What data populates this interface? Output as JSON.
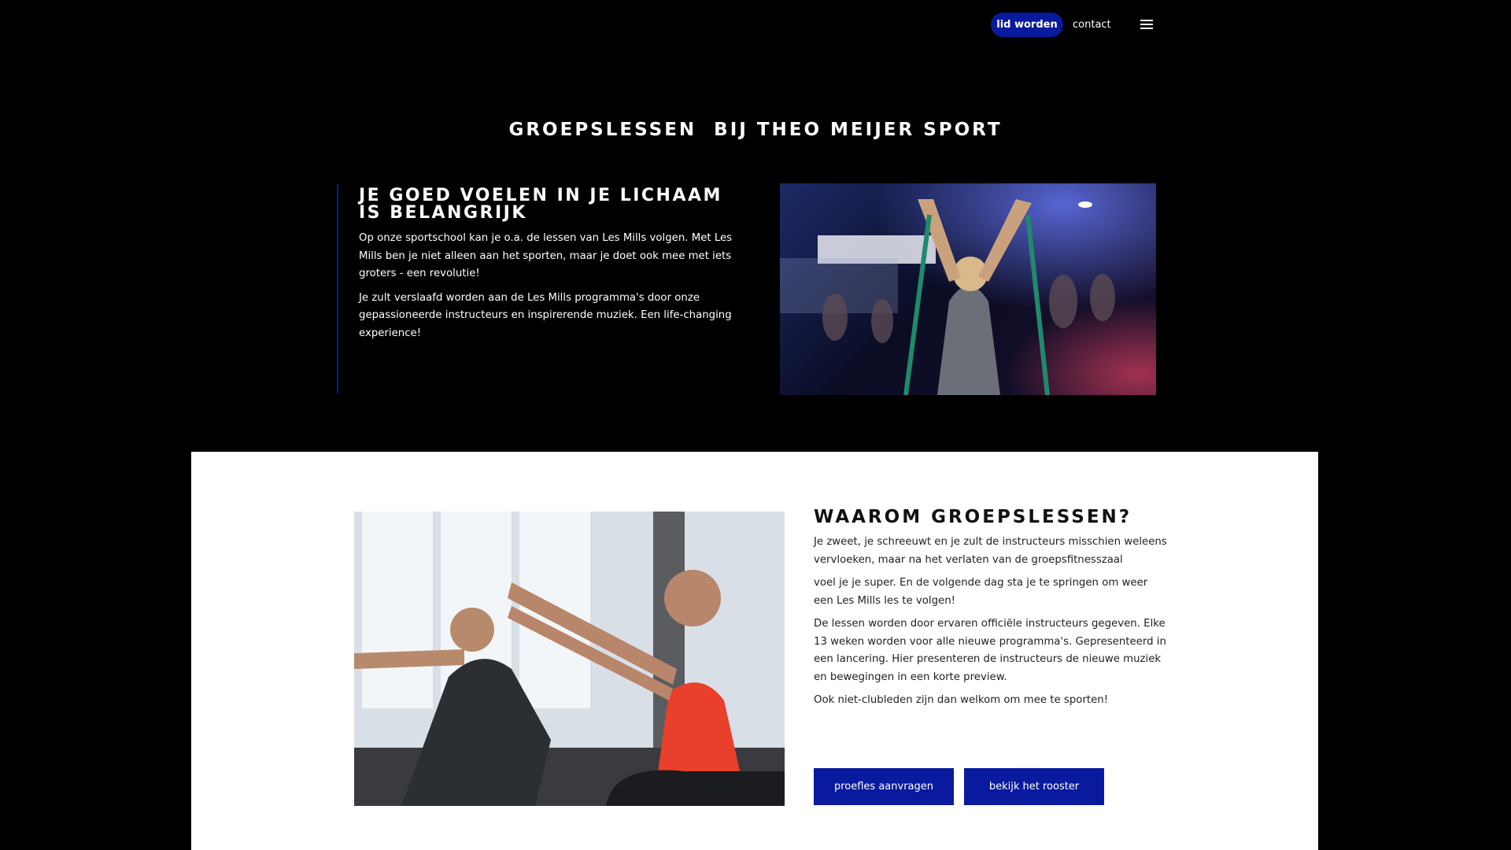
{
  "nav": {
    "join_label": "lid worden",
    "contact_label": "contact",
    "menu_icon": "hamburger-menu-icon"
  },
  "hero": {
    "title": "GROEPSLESSEN  BIJ THEO MEIJER SPORT"
  },
  "intro": {
    "heading": "JE GOED VOELEN IN JE LICHAAM IS BELANGRIJK",
    "paragraphs": [
      "Op onze sportschool kan je o.a. de lessen van Les Mills volgen. Met Les Mills ben je niet alleen aan het sporten, maar je doet ook mee met iets groters - een revolutie!",
      "Je zult verslaafd worden aan de Les Mills programma's door onze gepassioneerde instructeurs en inspirerende muziek. Een life-changing experience!"
    ]
  },
  "why": {
    "heading": "WAAROM GROEPSLESSEN?",
    "paragraphs": [
      "Je zweet, je schreeuwt en je zult de instructeurs misschien weleens vervloeken, maar na het verlaten van de groepsfitnesszaal",
      "voel je je super. En de volgende dag sta je te springen om weer een Les Mills les te volgen!",
      "De lessen worden door ervaren officiële instructeurs gegeven. Elke 13 weken worden voor alle nieuwe programma's. Gepresenteerd in een lancering. Hier presenteren de instructeurs de nieuwe muziek en bewegingen in een korte preview.",
      "Ook niet-clubleden zijn dan welkom om mee te sporten!"
    ],
    "buttons": {
      "trial": "proefles aanvragen",
      "schedule": "bekijk het rooster"
    }
  },
  "colors": {
    "accent": "#0a1a9e",
    "background": "#000000",
    "panel": "#ffffff"
  }
}
